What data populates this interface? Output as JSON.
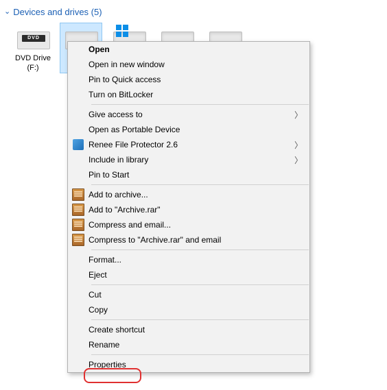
{
  "section": {
    "title": "Devices and drives (5)"
  },
  "drives": {
    "dvd_label_line1": "DVD Drive",
    "dvd_label_line2": "(F:)",
    "dvd_badge": "DVD"
  },
  "menu": {
    "open": "Open",
    "open_new_window": "Open in new window",
    "pin_quick_access": "Pin to Quick access",
    "bitlocker": "Turn on BitLocker",
    "give_access": "Give access to",
    "open_portable": "Open as Portable Device",
    "renee": "Renee File Protector 2.6",
    "include_library": "Include in library",
    "pin_start": "Pin to Start",
    "add_archive": "Add to archive...",
    "add_archive_rar": "Add to \"Archive.rar\"",
    "compress_email": "Compress and email...",
    "compress_rar_email": "Compress to \"Archive.rar\" and email",
    "format": "Format...",
    "eject": "Eject",
    "cut": "Cut",
    "copy": "Copy",
    "create_shortcut": "Create shortcut",
    "rename": "Rename",
    "properties": "Properties"
  }
}
